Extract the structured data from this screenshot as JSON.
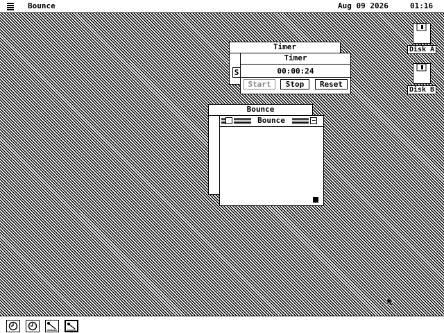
{
  "menubar": {
    "app_name": "Bounce",
    "date": "Aug 09 2026",
    "time": "01:16"
  },
  "desktop": {
    "disks": [
      {
        "label": "Disk A"
      },
      {
        "label": "Disk B"
      }
    ]
  },
  "timer_back": {
    "title": "Timer",
    "left_button_partial": "S"
  },
  "timer": {
    "title": "Timer",
    "display": "00:00:24",
    "buttons": {
      "start": "Start",
      "stop": "Stop",
      "reset": "Reset"
    },
    "start_enabled": false
  },
  "bounce_back": {
    "title": "Bounce"
  },
  "bounce": {
    "title": "Bounce"
  },
  "dock": {
    "items": [
      {
        "icon": "clock-icon",
        "active": false
      },
      {
        "icon": "clock-icon",
        "active": false
      },
      {
        "icon": "bounce-icon",
        "active": false
      },
      {
        "icon": "bounce-icon",
        "active": true
      }
    ]
  }
}
